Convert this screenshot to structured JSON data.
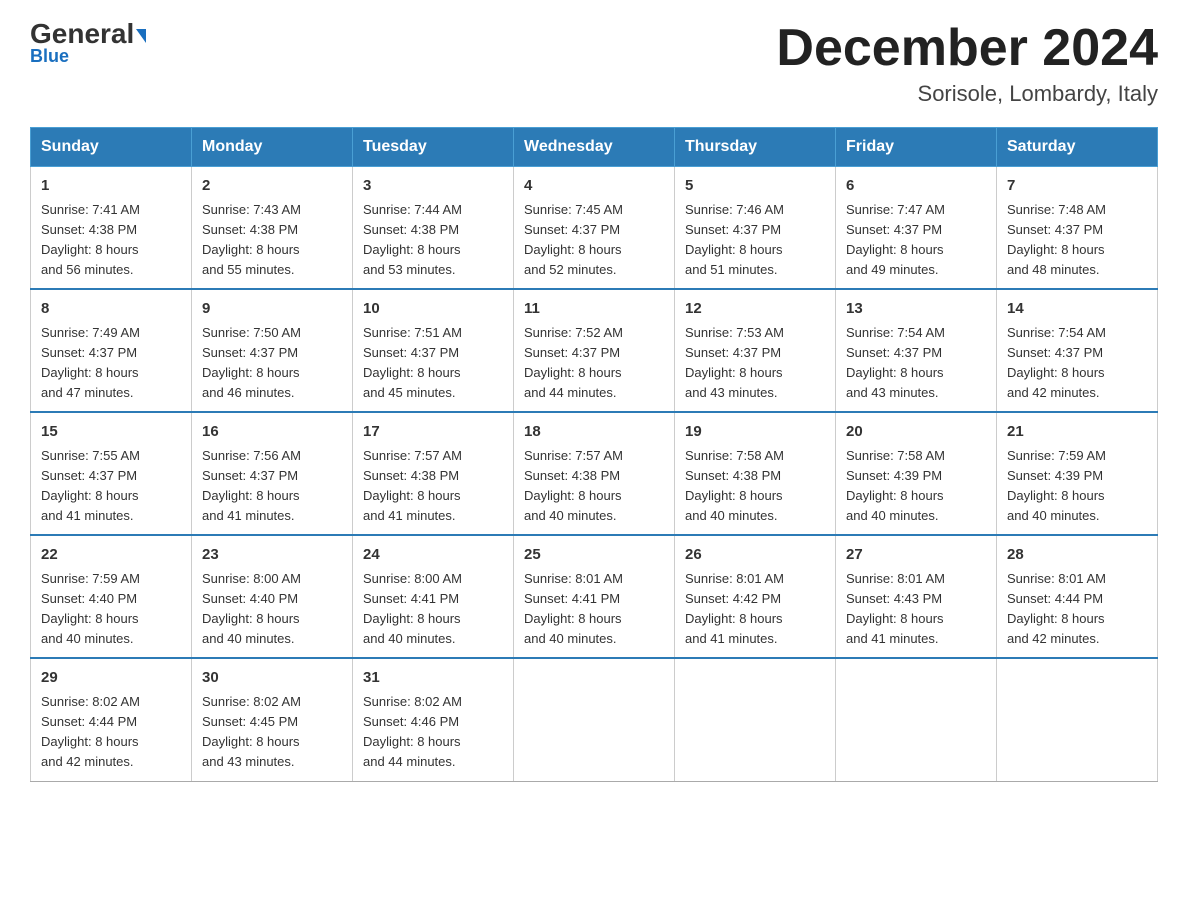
{
  "header": {
    "logo_text_general": "General",
    "logo_text_blue": "Blue",
    "month_title": "December 2024",
    "location": "Sorisole, Lombardy, Italy"
  },
  "days_of_week": [
    "Sunday",
    "Monday",
    "Tuesday",
    "Wednesday",
    "Thursday",
    "Friday",
    "Saturday"
  ],
  "weeks": [
    [
      {
        "day": "1",
        "sunrise": "7:41 AM",
        "sunset": "4:38 PM",
        "daylight": "8 hours and 56 minutes."
      },
      {
        "day": "2",
        "sunrise": "7:43 AM",
        "sunset": "4:38 PM",
        "daylight": "8 hours and 55 minutes."
      },
      {
        "day": "3",
        "sunrise": "7:44 AM",
        "sunset": "4:38 PM",
        "daylight": "8 hours and 53 minutes."
      },
      {
        "day": "4",
        "sunrise": "7:45 AM",
        "sunset": "4:37 PM",
        "daylight": "8 hours and 52 minutes."
      },
      {
        "day": "5",
        "sunrise": "7:46 AM",
        "sunset": "4:37 PM",
        "daylight": "8 hours and 51 minutes."
      },
      {
        "day": "6",
        "sunrise": "7:47 AM",
        "sunset": "4:37 PM",
        "daylight": "8 hours and 49 minutes."
      },
      {
        "day": "7",
        "sunrise": "7:48 AM",
        "sunset": "4:37 PM",
        "daylight": "8 hours and 48 minutes."
      }
    ],
    [
      {
        "day": "8",
        "sunrise": "7:49 AM",
        "sunset": "4:37 PM",
        "daylight": "8 hours and 47 minutes."
      },
      {
        "day": "9",
        "sunrise": "7:50 AM",
        "sunset": "4:37 PM",
        "daylight": "8 hours and 46 minutes."
      },
      {
        "day": "10",
        "sunrise": "7:51 AM",
        "sunset": "4:37 PM",
        "daylight": "8 hours and 45 minutes."
      },
      {
        "day": "11",
        "sunrise": "7:52 AM",
        "sunset": "4:37 PM",
        "daylight": "8 hours and 44 minutes."
      },
      {
        "day": "12",
        "sunrise": "7:53 AM",
        "sunset": "4:37 PM",
        "daylight": "8 hours and 43 minutes."
      },
      {
        "day": "13",
        "sunrise": "7:54 AM",
        "sunset": "4:37 PM",
        "daylight": "8 hours and 43 minutes."
      },
      {
        "day": "14",
        "sunrise": "7:54 AM",
        "sunset": "4:37 PM",
        "daylight": "8 hours and 42 minutes."
      }
    ],
    [
      {
        "day": "15",
        "sunrise": "7:55 AM",
        "sunset": "4:37 PM",
        "daylight": "8 hours and 41 minutes."
      },
      {
        "day": "16",
        "sunrise": "7:56 AM",
        "sunset": "4:37 PM",
        "daylight": "8 hours and 41 minutes."
      },
      {
        "day": "17",
        "sunrise": "7:57 AM",
        "sunset": "4:38 PM",
        "daylight": "8 hours and 41 minutes."
      },
      {
        "day": "18",
        "sunrise": "7:57 AM",
        "sunset": "4:38 PM",
        "daylight": "8 hours and 40 minutes."
      },
      {
        "day": "19",
        "sunrise": "7:58 AM",
        "sunset": "4:38 PM",
        "daylight": "8 hours and 40 minutes."
      },
      {
        "day": "20",
        "sunrise": "7:58 AM",
        "sunset": "4:39 PM",
        "daylight": "8 hours and 40 minutes."
      },
      {
        "day": "21",
        "sunrise": "7:59 AM",
        "sunset": "4:39 PM",
        "daylight": "8 hours and 40 minutes."
      }
    ],
    [
      {
        "day": "22",
        "sunrise": "7:59 AM",
        "sunset": "4:40 PM",
        "daylight": "8 hours and 40 minutes."
      },
      {
        "day": "23",
        "sunrise": "8:00 AM",
        "sunset": "4:40 PM",
        "daylight": "8 hours and 40 minutes."
      },
      {
        "day": "24",
        "sunrise": "8:00 AM",
        "sunset": "4:41 PM",
        "daylight": "8 hours and 40 minutes."
      },
      {
        "day": "25",
        "sunrise": "8:01 AM",
        "sunset": "4:41 PM",
        "daylight": "8 hours and 40 minutes."
      },
      {
        "day": "26",
        "sunrise": "8:01 AM",
        "sunset": "4:42 PM",
        "daylight": "8 hours and 41 minutes."
      },
      {
        "day": "27",
        "sunrise": "8:01 AM",
        "sunset": "4:43 PM",
        "daylight": "8 hours and 41 minutes."
      },
      {
        "day": "28",
        "sunrise": "8:01 AM",
        "sunset": "4:44 PM",
        "daylight": "8 hours and 42 minutes."
      }
    ],
    [
      {
        "day": "29",
        "sunrise": "8:02 AM",
        "sunset": "4:44 PM",
        "daylight": "8 hours and 42 minutes."
      },
      {
        "day": "30",
        "sunrise": "8:02 AM",
        "sunset": "4:45 PM",
        "daylight": "8 hours and 43 minutes."
      },
      {
        "day": "31",
        "sunrise": "8:02 AM",
        "sunset": "4:46 PM",
        "daylight": "8 hours and 44 minutes."
      },
      null,
      null,
      null,
      null
    ]
  ],
  "labels": {
    "sunrise": "Sunrise:",
    "sunset": "Sunset:",
    "daylight": "Daylight:"
  }
}
